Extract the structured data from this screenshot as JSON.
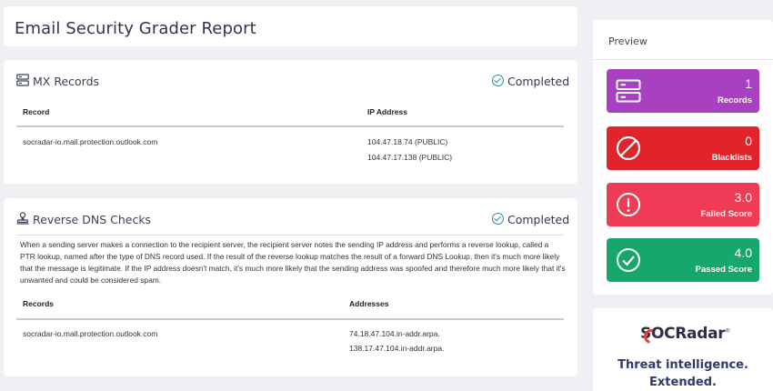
{
  "page": {
    "title": "Email Security Grader Report"
  },
  "mx": {
    "title": "MX Records",
    "icon": "server-icon",
    "status": "Completed",
    "columns": [
      "Record",
      "IP Address"
    ],
    "rows": [
      {
        "record": "socradar-io.mail.protection.outlook.com",
        "ips": [
          "104.47.18.74 (PUBLIC)",
          "104.47.17.138 (PUBLIC)"
        ]
      }
    ]
  },
  "rdns": {
    "title": "Reverse DNS Checks",
    "icon": "stamp-icon",
    "status": "Completed",
    "description": "When a sending server makes a connection to the recipient server, the recipient server notes the sending IP address and performs a reverse lookup, called a PTR lookup, named after the type of DNS record used. If the result of the reverse lookup matches the result of a forward DNS Lookup, then it's much more likely that the message is legitimate. If the IP address doesn't match, it's much more likely that the sending address was spoofed and therefore much more likely that it's unwanted and could be considered spam.",
    "columns": [
      "Records",
      "Addresses"
    ],
    "rows": [
      {
        "record": "socradar-io.mail.protection.outlook.com",
        "addresses": [
          "74.18.47.104.in-addr.arpa.",
          "138.17.47.104.in-addr.arpa."
        ]
      }
    ]
  },
  "preview": {
    "title": "Preview",
    "stats": [
      {
        "value": "1",
        "label": "Records",
        "icon": "server-icon",
        "color": "#a741c1"
      },
      {
        "value": "0",
        "label": "Blacklists",
        "icon": "prohibited-icon",
        "color": "#e0242a"
      },
      {
        "value": "3.0",
        "label": "Failed Score",
        "icon": "exclamation-icon",
        "color": "#f03b57"
      },
      {
        "value": "4.0",
        "label": "Passed Score",
        "icon": "check-circle-icon",
        "color": "#16a86a"
      }
    ]
  },
  "brand": {
    "logo": "SOCRadar",
    "registered": "®",
    "tagline_line1": "Threat intelligence.",
    "tagline_line2": "Extended."
  }
}
